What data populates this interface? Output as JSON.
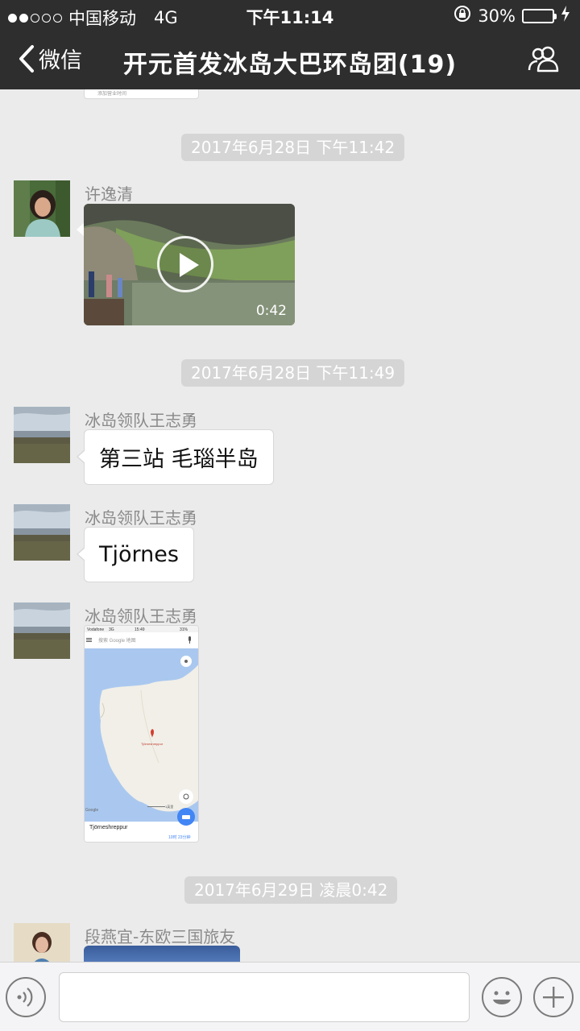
{
  "status_bar": {
    "carrier": "中国移动",
    "network": "4G",
    "time": "下午11:14",
    "battery": "30%",
    "battery_level": 0.3
  },
  "nav": {
    "back_label": "微信",
    "title": "开元首发冰岛大巴环岛团(19)",
    "members_icon": "people-icon"
  },
  "prev_message": {
    "caption": "添加营业时间"
  },
  "messages": [
    {
      "kind": "timestamp",
      "text": "2017年6月28日 下午11:42"
    },
    {
      "kind": "video",
      "sender": "许逸清",
      "duration": "0:42"
    },
    {
      "kind": "timestamp",
      "text": "2017年6月28日 下午11:49"
    },
    {
      "kind": "text",
      "sender": "冰岛领队王志勇",
      "text": "第三站 毛瑙半岛"
    },
    {
      "kind": "text",
      "sender": "冰岛领队王志勇",
      "text": "Tjörnes"
    },
    {
      "kind": "image",
      "sender": "冰岛领队王志勇",
      "map": {
        "carrier": "Vodafone",
        "network": "3G",
        "time": "15:49",
        "battery": "31%",
        "search_placeholder": "搜索 Google 地图",
        "pin_label": "Tjörneshreppur",
        "place_name": "Tjörneshreppur",
        "drive_time": "10时 23分钟",
        "logo": "Google",
        "scale": "1英里"
      }
    },
    {
      "kind": "timestamp",
      "text": "2017年6月29日 凌晨0:42"
    },
    {
      "kind": "image-partial",
      "sender": "段燕宜-东欧三国旅友"
    }
  ],
  "input_bar": {
    "voice_icon": "voice-icon",
    "emoji_icon": "emoji-icon",
    "plus_icon": "plus-icon",
    "text_value": ""
  }
}
